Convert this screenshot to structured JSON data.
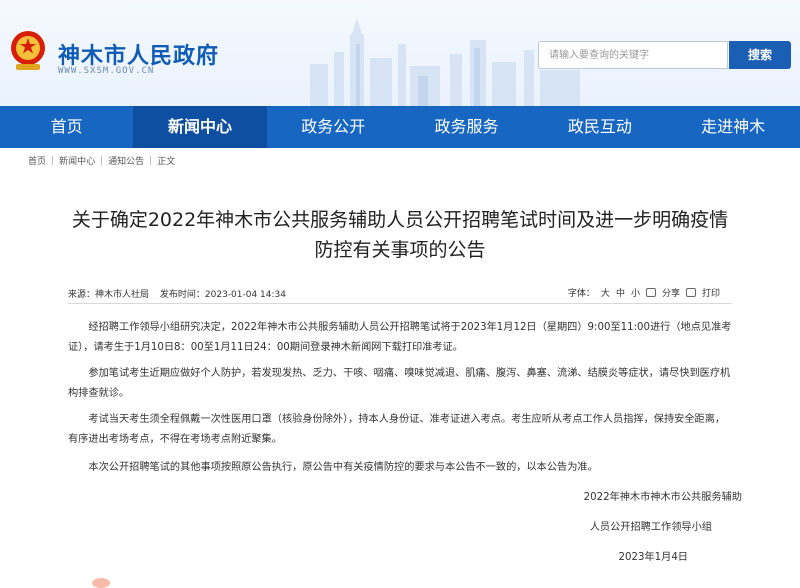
{
  "header": {
    "site_title": "神木市人民政府",
    "site_domain": "WWW.SXSM.GOV.CN",
    "search_placeholder": "请输入要查询的关键字",
    "search_button": "搜索"
  },
  "nav": {
    "items": [
      "首页",
      "新闻中心",
      "政务公开",
      "政务服务",
      "政民互动",
      "走进神木"
    ],
    "active": "新闻中心"
  },
  "breadcrumb": [
    "首页",
    "新闻中心",
    "通知公告",
    "正文"
  ],
  "article": {
    "title_line1": "关于确定2022年神木市公共服务辅助人员公开招聘笔试时间及进一步明确疫情",
    "title_line2": "防控有关事项的公告",
    "source": "来源：神木市人社局",
    "date": "发布时间：2023-01-04 14:34",
    "font_label": "字体：",
    "font_sizes": [
      "大",
      "中",
      "小"
    ],
    "share": "分享",
    "print": "打印",
    "paragraphs": [
      "经招聘工作领导小组研究决定，2022年神木市公共服务辅助人员公开招聘笔试将于2023年1月12日（星期四）9:00至11:00进行（地点见准考证），请考生于1月10日8：00至1月11日24：00期间登录神木新闻网下载打印准考证。",
      "参加笔试考生近期应做好个人防护，若发现发热、乏力、干咳、咽痛、嗅味觉减退、肌痛、腹泻、鼻塞、流涕、结膜炎等症状，请尽快到医疗机构排查就诊。",
      "考试当天考生须全程佩戴一次性医用口罩（核验身份除外），持本人身份证、准考证进入考点。考生应听从考点工作人员指挥，保持安全距离，有序进出考场考点，不得在考场考点附近聚集。",
      "本次公开招聘笔试的其他事项按照原公告执行，原公告中有关疫情防控的要求与本公告不一致的，以本公告为准。"
    ],
    "signature_line1": "2022年神木市神木市公共服务辅助",
    "signature_line2": "人员公开招聘工作领导小组",
    "signature_date": "2023年1月4日"
  }
}
